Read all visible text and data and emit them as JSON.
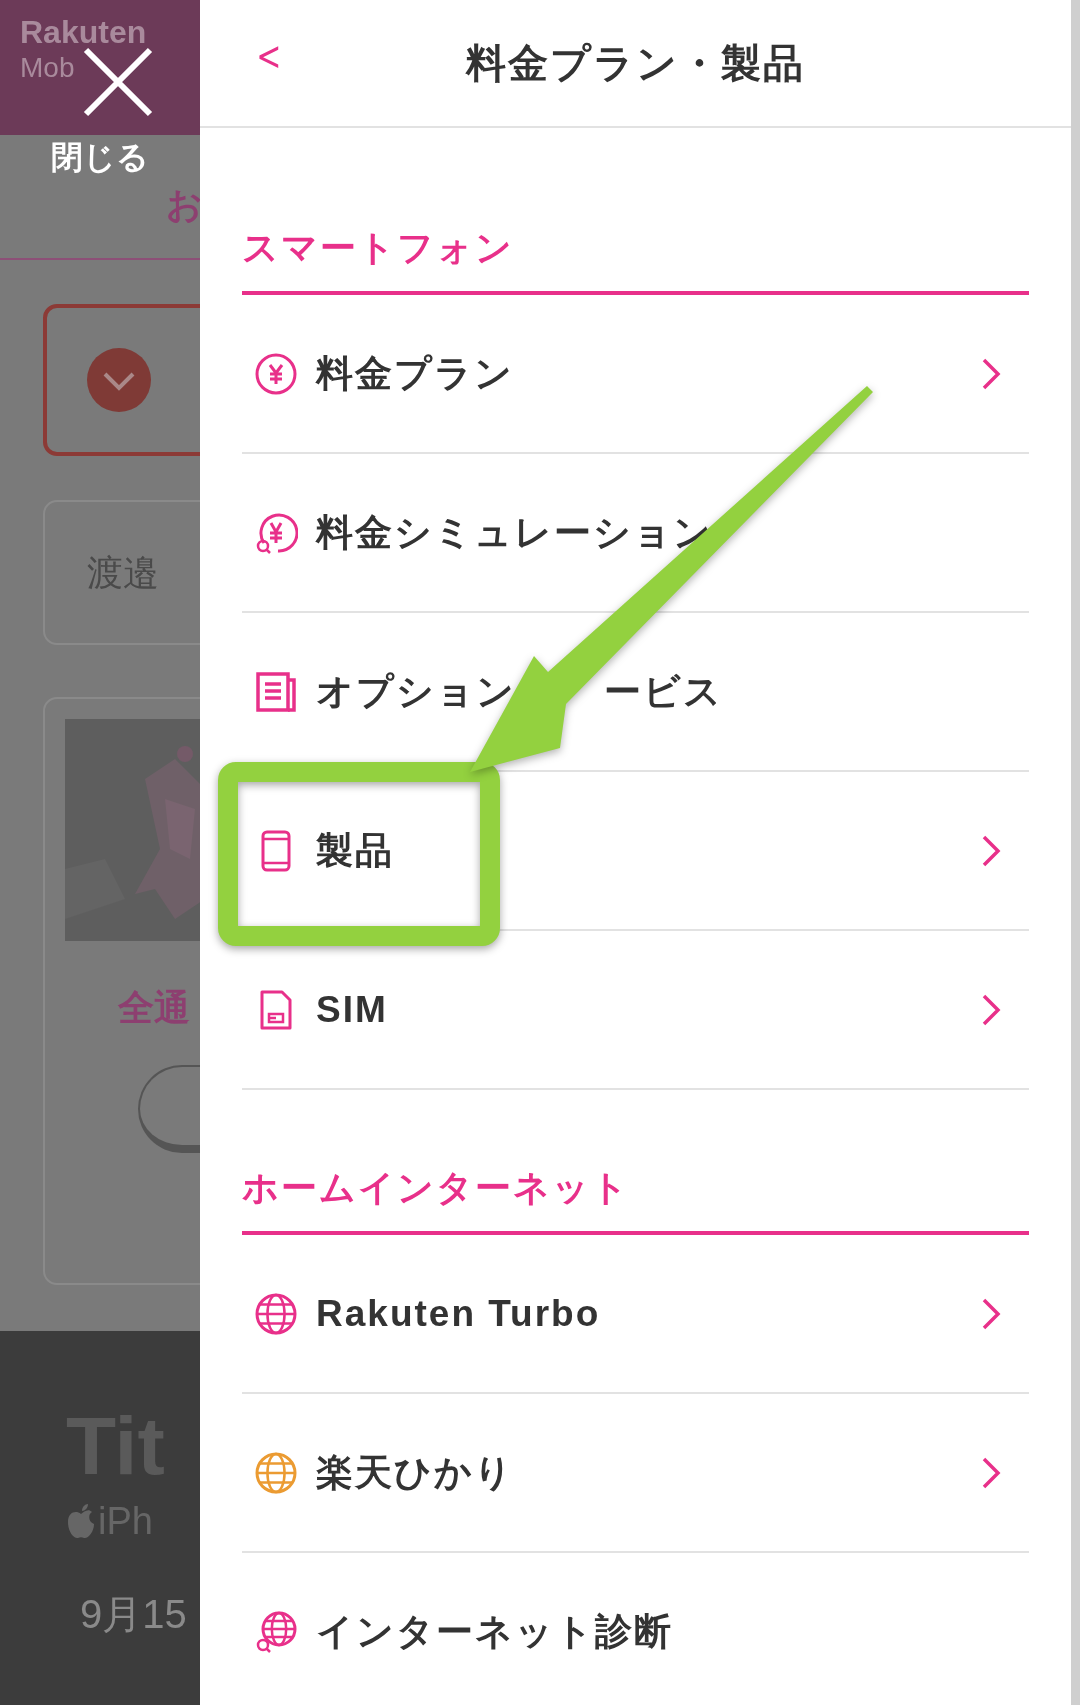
{
  "background": {
    "logo": [
      "Rakuten",
      "Mob"
    ],
    "close_label": "閉じる",
    "heading_fragment": "お",
    "name_fragment": "渡邉",
    "caption_fragment": "全通",
    "banner_title": "Tit",
    "banner_subtitle": "iPh",
    "banner_date": "9月15"
  },
  "header": {
    "back": "<",
    "title": "料金プラン・製品"
  },
  "sections": [
    {
      "heading": "スマートフォン",
      "items": [
        {
          "label": "料金プラン",
          "kind": "yen",
          "color": "#e8308a",
          "chevron": true
        },
        {
          "label": "料金シミュレーション",
          "kind": "yen-search",
          "color": "#e8308a",
          "chevron": false
        },
        {
          "label": "オプション",
          "label_after_arrow": "ービス",
          "kind": "document",
          "color": "#e8308a",
          "chevron": false
        },
        {
          "label": "製品",
          "kind": "phone",
          "color": "#e8308a",
          "chevron": true
        },
        {
          "label": "SIM",
          "kind": "sim",
          "color": "#e8308a",
          "chevron": true
        }
      ]
    },
    {
      "heading": "ホームインターネット",
      "items": [
        {
          "label": "Rakuten Turbo",
          "kind": "globe",
          "color": "#e8308a",
          "chevron": true
        },
        {
          "label": "楽天ひかり",
          "kind": "globe",
          "color": "#eb9b32",
          "chevron": true
        },
        {
          "label": "インターネット診断",
          "kind": "globe-search",
          "color": "#e8308a",
          "chevron": false
        }
      ]
    }
  ],
  "annotations": [
    {
      "kind": "highlight"
    },
    {
      "kind": "arrow"
    }
  ]
}
